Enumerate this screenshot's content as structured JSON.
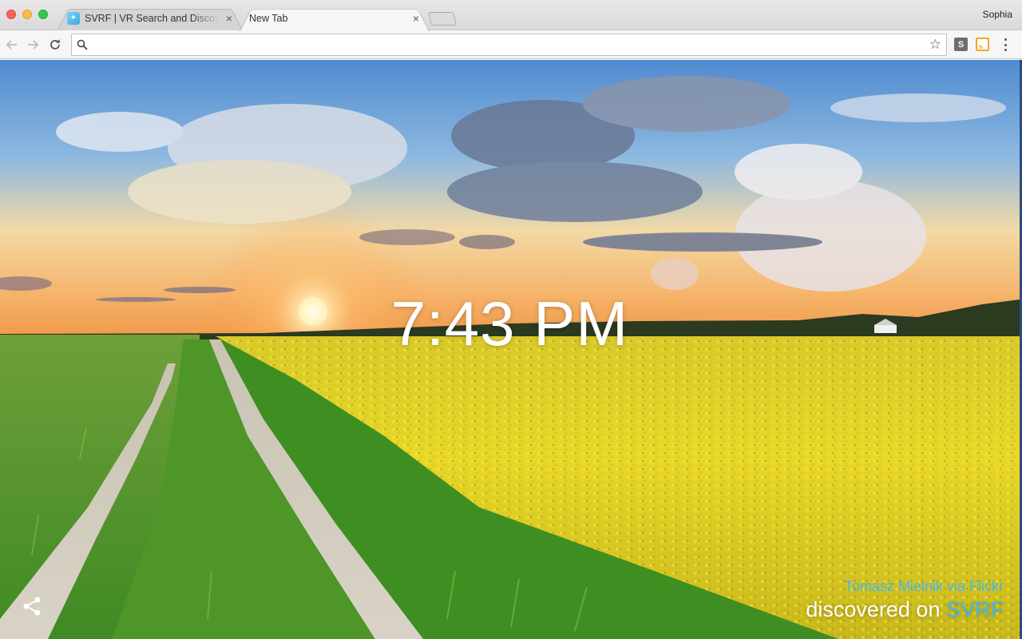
{
  "browser": {
    "tabs": [
      {
        "title": "SVRF | VR Search and Discove",
        "active": false,
        "favicon": "svrf-favicon"
      },
      {
        "title": "New Tab",
        "active": true
      }
    ],
    "tab_close_symbol": "×",
    "profile_name": "Sophia",
    "address_bar": {
      "value": "",
      "placeholder": ""
    },
    "extensions": [
      {
        "icon": "s-extension-icon",
        "label": "S"
      },
      {
        "icon": "cast-icon",
        "label": ""
      }
    ]
  },
  "page": {
    "clock": "7:43 PM",
    "photo_credit": "Tomasz Mielnik via Flickr",
    "discovered_prefix": "discovered on",
    "discovered_brand": "SVRF",
    "share_icon": "share-icon",
    "colors": {
      "accent": "#45b7ea",
      "field": "#e6d22a",
      "grass": "#5a9a2a",
      "sky_top": "#4f8bd0",
      "sunset": "#f2a85a"
    }
  }
}
